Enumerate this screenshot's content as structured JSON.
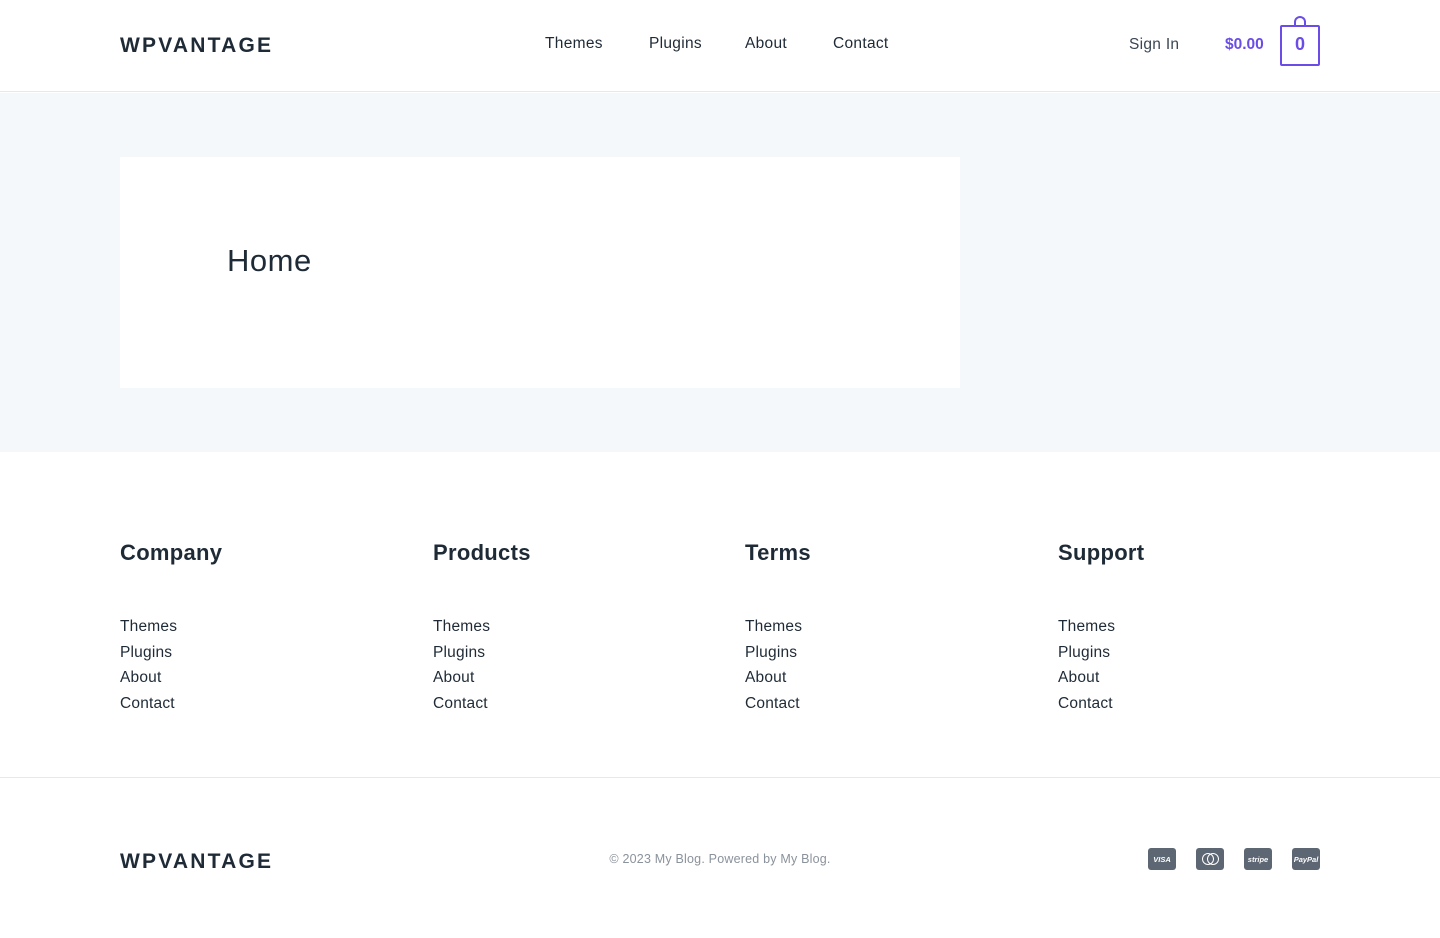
{
  "header": {
    "logo": "WPVANTAGE",
    "nav": [
      "Themes",
      "Plugins",
      "About",
      "Contact"
    ],
    "sign_in": "Sign In",
    "cart_total": "$0.00",
    "cart_count": "0",
    "accent_color": "#6b4ce6"
  },
  "main": {
    "page_title": "Home",
    "background": "#f5f8fa"
  },
  "footer": {
    "columns": [
      {
        "title": "Company",
        "links": [
          "Themes",
          "Plugins",
          "About",
          "Contact"
        ]
      },
      {
        "title": "Products",
        "links": [
          "Themes",
          "Plugins",
          "About",
          "Contact"
        ]
      },
      {
        "title": "Terms",
        "links": [
          "Themes",
          "Plugins",
          "About",
          "Contact"
        ]
      },
      {
        "title": "Support",
        "links": [
          "Themes",
          "Plugins",
          "About",
          "Contact"
        ]
      }
    ],
    "logo": "WPVANTAGE",
    "copyright": "© 2023 My Blog. Powered by My Blog.",
    "payment_icons": [
      "visa-icon",
      "mastercard-icon",
      "stripe-icon",
      "paypal-icon"
    ],
    "payment_labels": {
      "visa": "VISA",
      "stripe": "stripe",
      "paypal": "PayPal"
    }
  }
}
